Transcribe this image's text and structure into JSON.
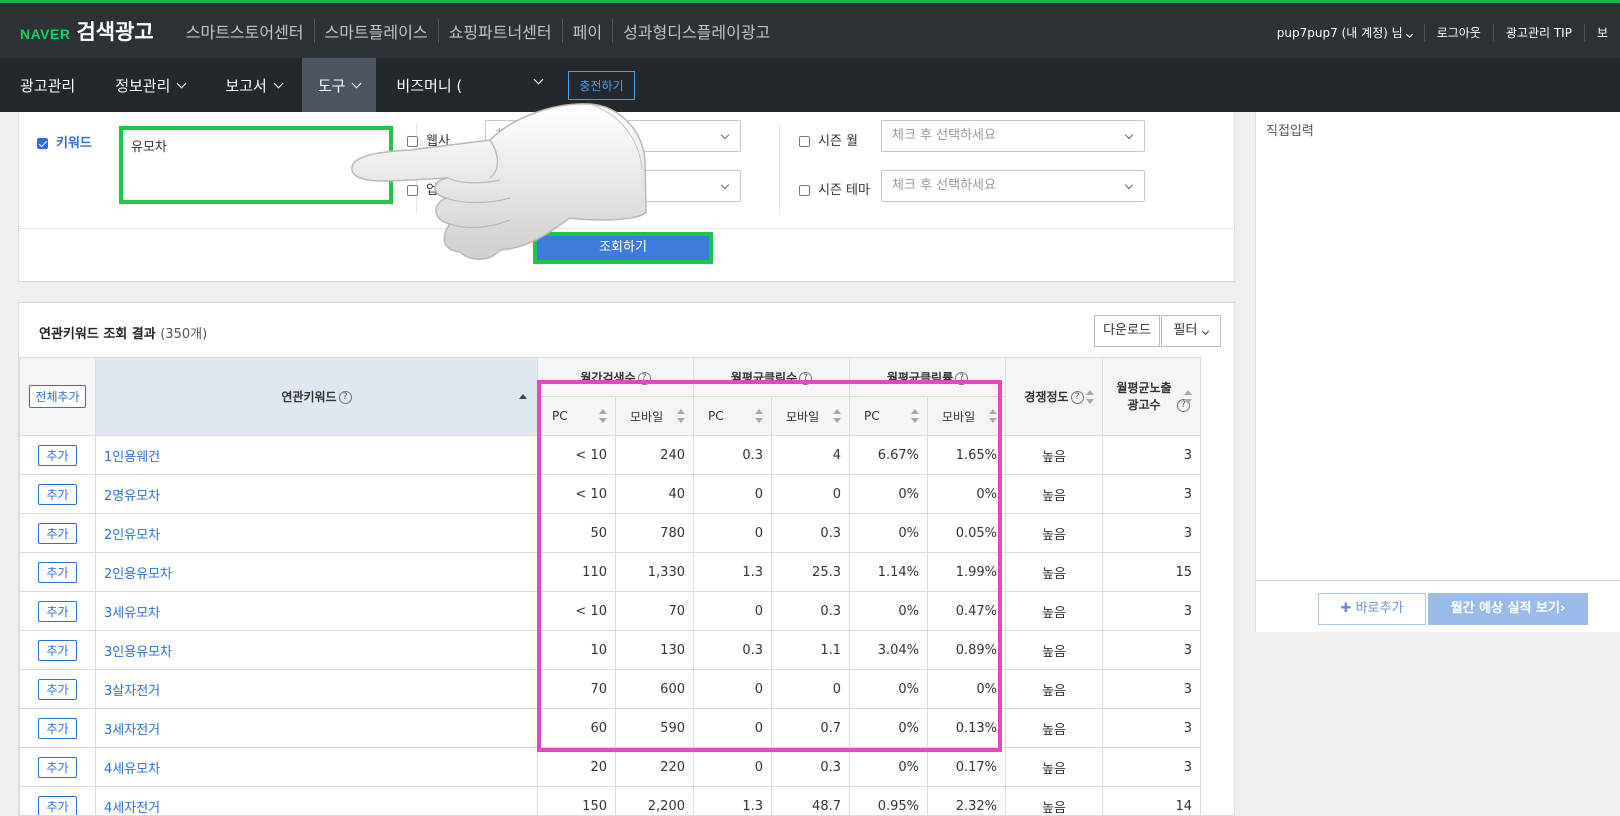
{
  "header": {
    "logo_naver": "NAVER",
    "logo_title": "검색광고",
    "nav": [
      "스마트스토어센터",
      "스마트플레이스",
      "쇼핑파트너센터",
      "페이",
      "성과형디스플레이광고"
    ],
    "user": "pup7pup7 (내 계정) 님",
    "logout": "로그아웃",
    "tip": "광고관리 TIP",
    "cut": "보"
  },
  "menu": {
    "items": [
      "광고관리",
      "정보관리",
      "보고서",
      "도구",
      "비즈머니 ("
    ],
    "active": "도구",
    "charge": "충전하기"
  },
  "search": {
    "keyword_label": "키워드",
    "keyword_value": "유모차",
    "website_label": "웹사",
    "industry_label": "업종",
    "season_month_label": "시즌 월",
    "season_theme_label": "시즌 테마",
    "select_placeholder": "체크 후 선택하세요",
    "submit": "조회하기"
  },
  "right_panel": {
    "label": "직접입력",
    "add_direct": "바로추가",
    "forecast": "월간 예상 실적 보기"
  },
  "results": {
    "title": "연관키워드 조회 결과",
    "count": "(350개)",
    "download": "다운로드",
    "filter": "필터",
    "add_all": "전체추가",
    "headers": {
      "keyword": "연관키워드",
      "monthly_search": "월간검색수",
      "avg_clicks": "월평균클릭수",
      "avg_ctr": "월평균클릭률",
      "competition": "경쟁정도",
      "avg_ads": "월평균노출광고수",
      "pc": "PC",
      "mobile": "모바일"
    },
    "add_label": "추가",
    "rows": [
      {
        "kw": "1인용웨건",
        "s_pc": "< 10",
        "s_mo": "240",
        "c_pc": "0.3",
        "c_mo": "4",
        "r_pc": "6.67%",
        "r_mo": "1.65%",
        "comp": "높음",
        "ads": "3"
      },
      {
        "kw": "2명유모차",
        "s_pc": "< 10",
        "s_mo": "40",
        "c_pc": "0",
        "c_mo": "0",
        "r_pc": "0%",
        "r_mo": "0%",
        "comp": "높음",
        "ads": "3"
      },
      {
        "kw": "2인유모차",
        "s_pc": "50",
        "s_mo": "780",
        "c_pc": "0",
        "c_mo": "0.3",
        "r_pc": "0%",
        "r_mo": "0.05%",
        "comp": "높음",
        "ads": "3"
      },
      {
        "kw": "2인용유모차",
        "s_pc": "110",
        "s_mo": "1,330",
        "c_pc": "1.3",
        "c_mo": "25.3",
        "r_pc": "1.14%",
        "r_mo": "1.99%",
        "comp": "높음",
        "ads": "15"
      },
      {
        "kw": "3세유모차",
        "s_pc": "< 10",
        "s_mo": "70",
        "c_pc": "0",
        "c_mo": "0.3",
        "r_pc": "0%",
        "r_mo": "0.47%",
        "comp": "높음",
        "ads": "3"
      },
      {
        "kw": "3인용유모차",
        "s_pc": "10",
        "s_mo": "130",
        "c_pc": "0.3",
        "c_mo": "1.1",
        "r_pc": "3.04%",
        "r_mo": "0.89%",
        "comp": "높음",
        "ads": "3"
      },
      {
        "kw": "3살자전거",
        "s_pc": "70",
        "s_mo": "600",
        "c_pc": "0",
        "c_mo": "0",
        "r_pc": "0%",
        "r_mo": "0%",
        "comp": "높음",
        "ads": "3"
      },
      {
        "kw": "3세자전거",
        "s_pc": "60",
        "s_mo": "590",
        "c_pc": "0",
        "c_mo": "0.7",
        "r_pc": "0%",
        "r_mo": "0.13%",
        "comp": "높음",
        "ads": "3"
      },
      {
        "kw": "4세유모차",
        "s_pc": "20",
        "s_mo": "220",
        "c_pc": "0",
        "c_mo": "0.3",
        "r_pc": "0%",
        "r_mo": "0.17%",
        "comp": "높음",
        "ads": "3"
      },
      {
        "kw": "4세자전거",
        "s_pc": "150",
        "s_mo": "2,200",
        "c_pc": "1.3",
        "c_mo": "48.7",
        "r_pc": "0.95%",
        "r_mo": "2.32%",
        "comp": "높음",
        "ads": "14"
      }
    ]
  },
  "colors": {
    "highlight_green": "#1ec54b",
    "highlight_pink": "#e547bf",
    "link_blue": "#2d6fd6",
    "naver_green": "#19ce60"
  }
}
